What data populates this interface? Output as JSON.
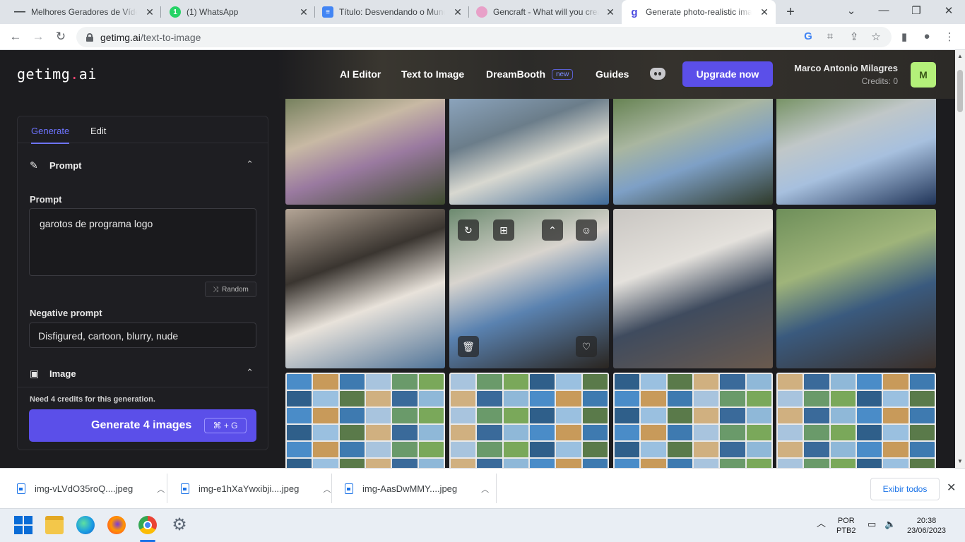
{
  "browser": {
    "tabs": [
      {
        "title": "Melhores Geradores de Víde",
        "icon": "dash-icon"
      },
      {
        "title": "(1) WhatsApp",
        "icon": "whatsapp-icon"
      },
      {
        "title": "Título: Desvendando o Mund",
        "icon": "docs-icon"
      },
      {
        "title": "Gencraft - What will you crea",
        "icon": "gencraft-icon"
      },
      {
        "title": "Generate photo-realistic ima",
        "icon": "getimg-icon",
        "active": true
      }
    ],
    "url_host": "getimg.ai",
    "url_path": "/text-to-image"
  },
  "site": {
    "logo_main": "getimg",
    "logo_dot": ".",
    "logo_ai": "ai",
    "nav": {
      "ai_editor": "AI Editor",
      "text_to_image": "Text to Image",
      "dreambooth": "DreamBooth",
      "new_badge": "new",
      "guides": "Guides"
    },
    "upgrade": "Upgrade now",
    "user_name": "Marco Antonio Milagres",
    "credits": "Credits: 0",
    "avatar_letter": "M"
  },
  "panel": {
    "tab_generate": "Generate",
    "tab_edit": "Edit",
    "prompt_section": "Prompt",
    "prompt_label": "Prompt",
    "prompt_value": "garotos de programa logo",
    "random": "Random",
    "negative_label": "Negative prompt",
    "negative_value": "Disfigured, cartoon, blurry, nude",
    "image_section": "Image",
    "note": "Need 4 credits for this generation.",
    "generate_button": "Generate 4 images",
    "shortcut": "⌘ + G"
  },
  "downloads": {
    "items": [
      "img-vLVdO35roQ....jpeg",
      "img-e1hXaYwxibji....jpeg",
      "img-AasDwMMY....jpeg"
    ],
    "show_all": "Exibir todos"
  },
  "taskbar": {
    "lang_top": "POR",
    "lang_bottom": "PTB2",
    "time": "20:38",
    "date": "23/06/2023"
  },
  "colors": {
    "accent": "#5b4fe9",
    "tab_active": "#6e74ff",
    "avatar": "#b4f07a"
  }
}
